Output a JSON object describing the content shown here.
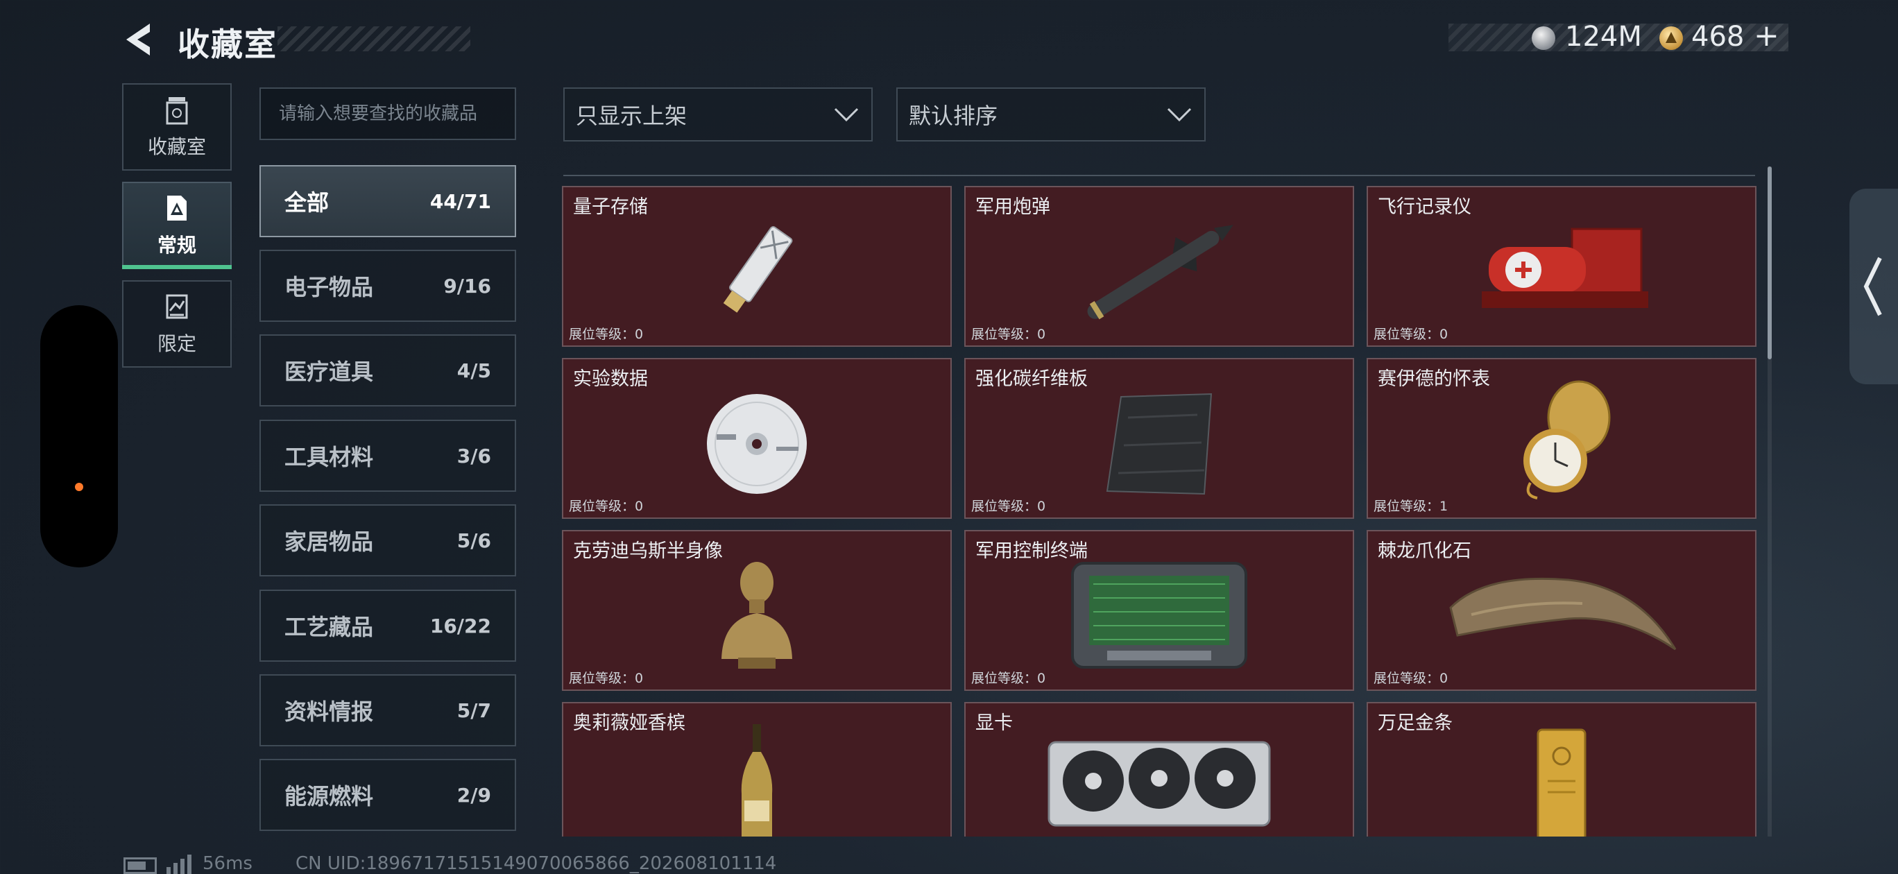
{
  "header": {
    "title": "收藏室",
    "currency_silver": "124M",
    "currency_gold": "468",
    "add_label": "+"
  },
  "rail": [
    {
      "label": "收藏室",
      "icon": "trash-bin-icon"
    },
    {
      "label": "常规",
      "icon": "triangle-document-icon"
    },
    {
      "label": "限定",
      "icon": "scroll-icon"
    }
  ],
  "search": {
    "placeholder": "请输入想要查找的收藏品",
    "value": ""
  },
  "categories": [
    {
      "label": "全部",
      "count": "44/71"
    },
    {
      "label": "电子物品",
      "count": "9/16"
    },
    {
      "label": "医疗道具",
      "count": "4/5"
    },
    {
      "label": "工具材料",
      "count": "3/6"
    },
    {
      "label": "家居物品",
      "count": "5/6"
    },
    {
      "label": "工艺藏品",
      "count": "16/22"
    },
    {
      "label": "资料情报",
      "count": "5/7"
    },
    {
      "label": "能源燃料",
      "count": "2/9"
    }
  ],
  "filters": {
    "display": "只显示上架",
    "sort": "默认排序"
  },
  "items": [
    {
      "name": "量子存储",
      "level": "展位等级：0",
      "icon": "usb-drive-icon"
    },
    {
      "name": "军用炮弹",
      "level": "展位等级：0",
      "icon": "missile-icon"
    },
    {
      "name": "飞行记录仪",
      "level": "展位等级：0",
      "icon": "flight-recorder-icon"
    },
    {
      "name": "实验数据",
      "level": "展位等级：0",
      "icon": "disc-icon"
    },
    {
      "name": "强化碳纤维板",
      "level": "展位等级：0",
      "icon": "carbon-plate-icon"
    },
    {
      "name": "赛伊德的怀表",
      "level": "展位等级：1",
      "icon": "pocket-watch-icon"
    },
    {
      "name": "克劳迪乌斯半身像",
      "level": "展位等级：0",
      "icon": "bust-icon"
    },
    {
      "name": "军用控制终端",
      "level": "展位等级：0",
      "icon": "terminal-icon"
    },
    {
      "name": "棘龙爪化石",
      "level": "展位等级：0",
      "icon": "claw-fossil-icon"
    },
    {
      "name": "奥莉薇娅香槟",
      "level": "",
      "icon": "champagne-icon"
    },
    {
      "name": "显卡",
      "level": "",
      "icon": "graphics-card-icon"
    },
    {
      "name": "万足金条",
      "level": "",
      "icon": "gold-bar-icon"
    }
  ],
  "footer": {
    "ping": "56ms",
    "uid": "CN UID:18967171515149070065866_202608101114"
  },
  "colors": {
    "accent": "#4fc38f",
    "card_bg": "#431c22",
    "card_border": "#6b545a",
    "bg": "#1d2631"
  }
}
